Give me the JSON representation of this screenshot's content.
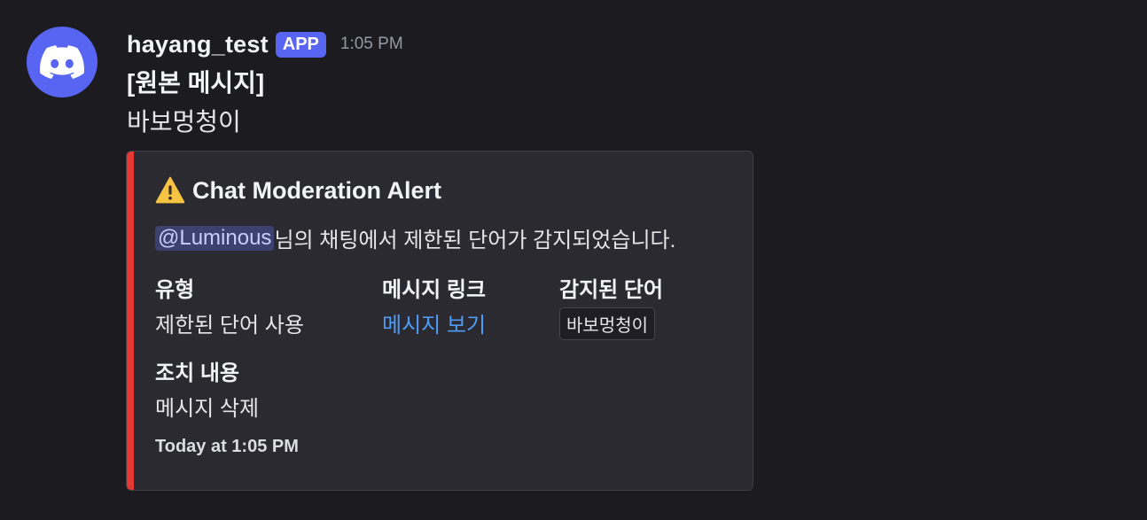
{
  "author": {
    "username": "hayang_test",
    "badge": "APP",
    "timestamp": "1:05 PM",
    "avatar_icon": "discord-logo-icon",
    "avatar_color": "#5865f2"
  },
  "message": {
    "original_title": "[원본 메시지]",
    "original_content": "바보멍청이"
  },
  "embed": {
    "accent_color": "#e53935",
    "title_icon": "warning-icon",
    "title": "Chat Moderation Alert",
    "mention": "@Luminous",
    "description_rest": "님의 채팅에서 제한된 단어가 감지되었습니다.",
    "fields": [
      {
        "name": "유형",
        "value": "제한된 단어 사용"
      },
      {
        "name": "메시지 링크",
        "value": "메시지 보기"
      },
      {
        "name": "감지된 단어",
        "value": "바보멍청이"
      },
      {
        "name": "조치 내용",
        "value": "메시지 삭제"
      }
    ],
    "footer": "Today at 1:05 PM"
  }
}
